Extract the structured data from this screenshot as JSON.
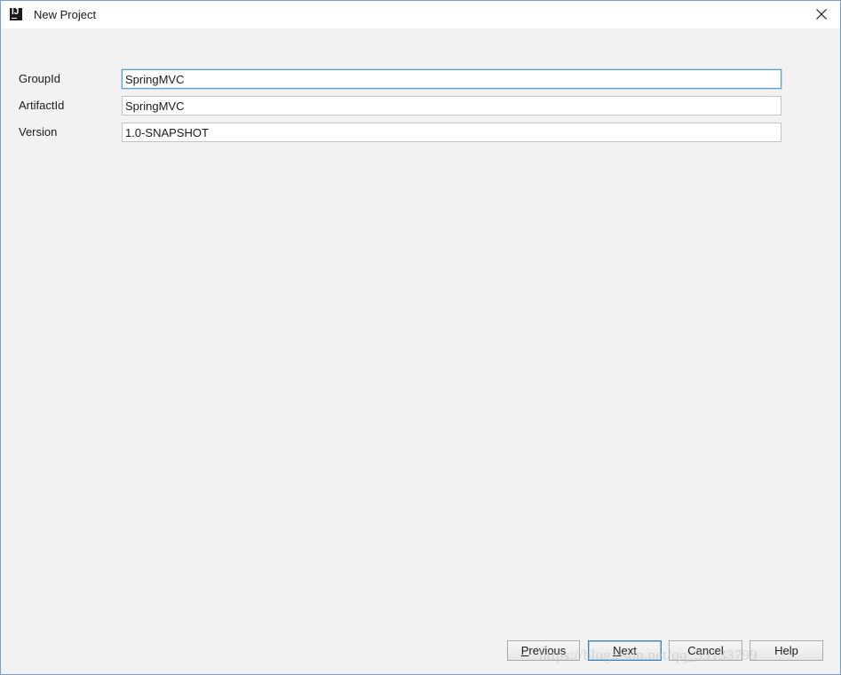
{
  "window": {
    "title": "New Project",
    "app_icon": "intellij-idea-icon",
    "close_icon": "close-icon"
  },
  "form": {
    "fields": [
      {
        "label": "GroupId",
        "value": "SpringMVC",
        "focused": true
      },
      {
        "label": "ArtifactId",
        "value": "SpringMVC",
        "focused": false
      },
      {
        "label": "Version",
        "value": "1.0-SNAPSHOT",
        "focused": false
      }
    ]
  },
  "buttons": {
    "previous": {
      "mnemonic": "P",
      "rest": "revious"
    },
    "next": {
      "mnemonic": "N",
      "rest": "ext"
    },
    "cancel": "Cancel",
    "help": "Help"
  },
  "watermark": "https://blog.csdn.net/qq_35133799",
  "colors": {
    "focus_border": "#5a9bd5",
    "dialog_background": "#f2f2f2",
    "window_border": "#7a9cc6"
  }
}
